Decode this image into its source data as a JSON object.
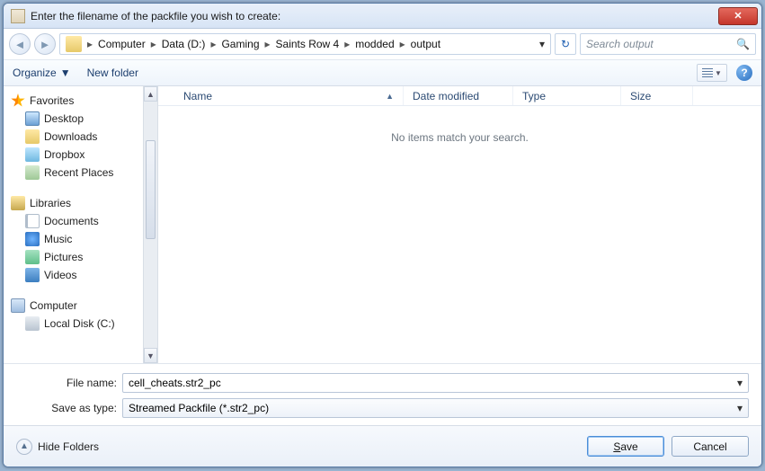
{
  "title": "Enter the filename of the packfile you wish to create:",
  "breadcrumb": [
    "Computer",
    "Data (D:)",
    "Gaming",
    "Saints Row 4",
    "modded",
    "output"
  ],
  "search_placeholder": "Search output",
  "toolbar": {
    "organize": "Organize",
    "newfolder": "New folder"
  },
  "tree": {
    "favorites": {
      "label": "Favorites",
      "items": [
        "Desktop",
        "Downloads",
        "Dropbox",
        "Recent Places"
      ]
    },
    "libraries": {
      "label": "Libraries",
      "items": [
        "Documents",
        "Music",
        "Pictures",
        "Videos"
      ]
    },
    "computer": {
      "label": "Computer",
      "items": [
        "Local Disk (C:)"
      ]
    }
  },
  "columns": {
    "name": "Name",
    "date": "Date modified",
    "type": "Type",
    "size": "Size"
  },
  "empty_msg": "No items match your search.",
  "file": {
    "name_lbl": "File name:",
    "name_val": "cell_cheats.str2_pc",
    "type_lbl": "Save as type:",
    "type_val": "Streamed Packfile (*.str2_pc)"
  },
  "footer": {
    "hide": "Hide Folders",
    "save": "Save",
    "cancel": "Cancel"
  }
}
